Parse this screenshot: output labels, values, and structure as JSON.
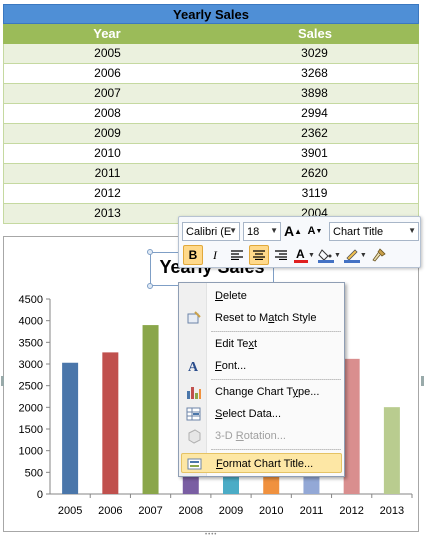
{
  "sheet": {
    "title": "Yearly Sales",
    "headers": [
      "Year",
      "Sales"
    ],
    "rows": [
      [
        "2005",
        "3029"
      ],
      [
        "2006",
        "3268"
      ],
      [
        "2007",
        "3898"
      ],
      [
        "2008",
        "2994"
      ],
      [
        "2009",
        "2362"
      ],
      [
        "2010",
        "3901"
      ],
      [
        "2011",
        "2620"
      ],
      [
        "2012",
        "3119"
      ],
      [
        "2013",
        "2004"
      ]
    ]
  },
  "chart_data": {
    "type": "bar",
    "title": "Yearly Sales",
    "categories": [
      "2005",
      "2006",
      "2007",
      "2008",
      "2009",
      "2010",
      "2011",
      "2012",
      "2013"
    ],
    "values": [
      3029,
      3268,
      3898,
      2994,
      2362,
      3901,
      2620,
      3119,
      2004
    ],
    "colors": [
      "#4a76aa",
      "#c0504d",
      "#8aa64a",
      "#7a5ea3",
      "#4bacc6",
      "#f0913e",
      "#93a8d6",
      "#d98e8e",
      "#b9cc8f"
    ],
    "yticks": [
      "0",
      "500",
      "1000",
      "1500",
      "2000",
      "2500",
      "3000",
      "3500",
      "4000",
      "4500"
    ],
    "ylim": [
      0,
      4500
    ],
    "grid": false,
    "legend": "none"
  },
  "minibar": {
    "font_name": "Calibri (E",
    "font_size": "18",
    "element": "Chart Title",
    "bold": "B",
    "italic": "I",
    "grow_font": "A",
    "shrink_font": "A",
    "font_color_glyph": "A"
  },
  "menu": {
    "delete": "elete",
    "delete_u": "D",
    "reset_a": "Reset to M",
    "reset_u": "a",
    "reset_b": "tch Style",
    "edit_text": "Edit Te",
    "edit_text_u": "x",
    "edit_text_b": "t",
    "font": "ont...",
    "font_u": "F",
    "change_type_a": "Change Chart T",
    "change_type_u": "y",
    "change_type_b": "pe...",
    "select_data": "elect Data...",
    "select_data_u": "S",
    "rotation_a": "3-D ",
    "rotation_u": "R",
    "rotation_b": "otation...",
    "format_title": "ormat Chart Title...",
    "format_title_u": "F"
  },
  "colors": {
    "accent_blue": "#4f8fd6",
    "header_green": "#9bbb59",
    "row_band": "#ebf1de",
    "menu_hover": "#fde7a5"
  }
}
